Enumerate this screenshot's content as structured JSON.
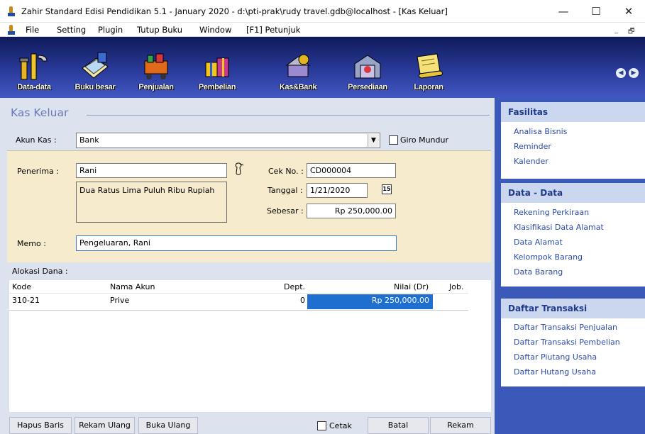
{
  "window": {
    "title": "Zahir Standard Edisi Pendidikan 5.1 - January 2020 - d:\\pti-prak\\rudy travel.gdb@localhost - [Kas Keluar]",
    "minimize": "—",
    "maximize": "☐",
    "close": "✕"
  },
  "menu": {
    "items": [
      "File",
      "Setting",
      "Plugin",
      "Tutup Buku",
      "Window",
      "[F1] Petunjuk"
    ],
    "mdi_min": "_",
    "mdi_restore": "🗗"
  },
  "toolbar": {
    "buttons": [
      {
        "label": "Data-data",
        "icon": "tools-icon"
      },
      {
        "label": "Buku besar",
        "icon": "ledger-icon"
      },
      {
        "label": "Penjualan",
        "icon": "cart-icon"
      },
      {
        "label": "Pembelian",
        "icon": "gifts-icon"
      },
      {
        "label": "Kas&Bank",
        "icon": "bank-icon"
      },
      {
        "label": "Persediaan",
        "icon": "warehouse-icon"
      },
      {
        "label": "Laporan",
        "icon": "scroll-icon"
      }
    ],
    "nav_prev": "◀",
    "nav_next": "▶"
  },
  "form": {
    "heading": "Kas Keluar",
    "akun_kas_label": "Akun Kas :",
    "akun_kas_value": "Bank",
    "giro_label": "Giro Mundur",
    "penerima_label": "Penerima :",
    "penerima_value": "Rani",
    "terbilang": "Dua Ratus Lima Puluh Ribu Rupiah",
    "cek_label": "Cek No. :",
    "cek_value": "CD000004",
    "tanggal_label": "Tanggal :",
    "tanggal_value": "1/21/2020",
    "calendar_glyph": "15",
    "sebesar_label": "Sebesar :",
    "sebesar_value": "Rp 250,000.00",
    "memo_label": "Memo :",
    "memo_value": "Pengeluaran, Rani",
    "alokasi_label": "Alokasi Dana :"
  },
  "grid": {
    "columns": [
      "Kode",
      "Nama Akun",
      "Dept.",
      "Nilai (Dr)",
      "Job."
    ],
    "rows": [
      {
        "kode": "310-21",
        "nama": "Prive",
        "dept": "0",
        "nilai": "Rp 250,000.00",
        "job": ""
      }
    ]
  },
  "buttons": {
    "hapus": "Hapus Baris",
    "rekam_ulang": "Rekam Ulang",
    "buka_ulang": "Buka Ulang",
    "cetak": "Cetak",
    "batal": "Batal",
    "rekam": "Rekam"
  },
  "sidebar": {
    "fasilitas": {
      "title": "Fasilitas",
      "links": [
        "Analisa Bisnis",
        "Reminder",
        "Kalender"
      ]
    },
    "data": {
      "title": "Data - Data",
      "links": [
        "Rekening Perkiraan",
        "Klasifikasi Data Alamat",
        "Data Alamat",
        "Kelompok Barang",
        "Data Barang"
      ]
    },
    "transaksi": {
      "title": "Daftar Transaksi",
      "links": [
        "Daftar Transaksi Penjualan",
        "Daftar Transaksi Pembelian",
        "Daftar Piutang Usaha",
        "Daftar Hutang Usaha"
      ]
    }
  },
  "colors": {
    "toolbar": "#2a3a9a",
    "form_bg": "#dde2ef",
    "beige": "#f6eccd",
    "sidebar": "#3a59b8",
    "selection": "#1f6fd1"
  }
}
